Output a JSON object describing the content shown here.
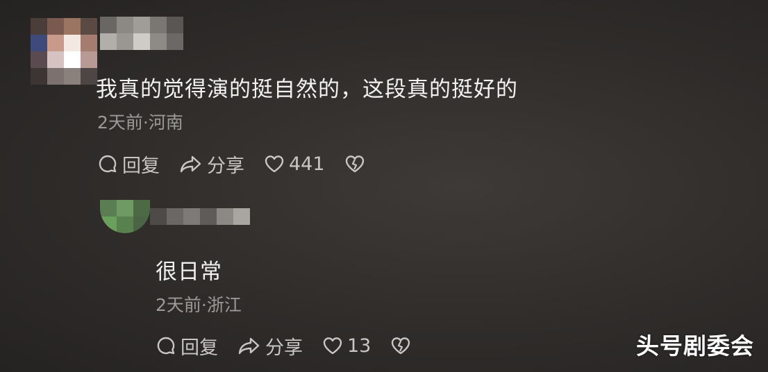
{
  "comments": [
    {
      "text": "我真的觉得演的挺自然的，这段真的挺好的",
      "meta": "2天前·河南",
      "reply_label": "回复",
      "share_label": "分享",
      "likes": "441"
    },
    {
      "text": "很日常",
      "meta": "2天前·浙江",
      "reply_label": "回复",
      "share_label": "分享",
      "likes": "13"
    }
  ],
  "watermark": "头号剧委会",
  "icons": {
    "reply": "comment-bubble-icon",
    "share": "share-arrow-icon",
    "like": "heart-icon",
    "dislike": "broken-heart-icon"
  }
}
